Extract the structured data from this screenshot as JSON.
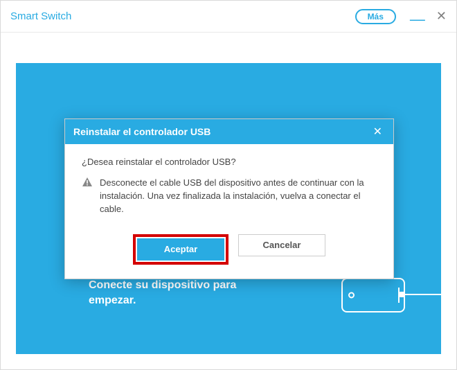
{
  "app": {
    "title": "Smart Switch",
    "more_label": "Más"
  },
  "panel": {
    "connect_text": "Conecte su dispositivo para empezar."
  },
  "modal": {
    "title": "Reinstalar el controlador USB",
    "question": "¿Desea reinstalar el controlador USB?",
    "warning": "Desconecte el cable USB del dispositivo antes de continuar con la instalación. Una vez finalizada la instalación, vuelva a conectar el cable.",
    "accept_label": "Aceptar",
    "cancel_label": "Cancelar"
  },
  "colors": {
    "accent": "#29abe2",
    "highlight": "#d40000"
  }
}
